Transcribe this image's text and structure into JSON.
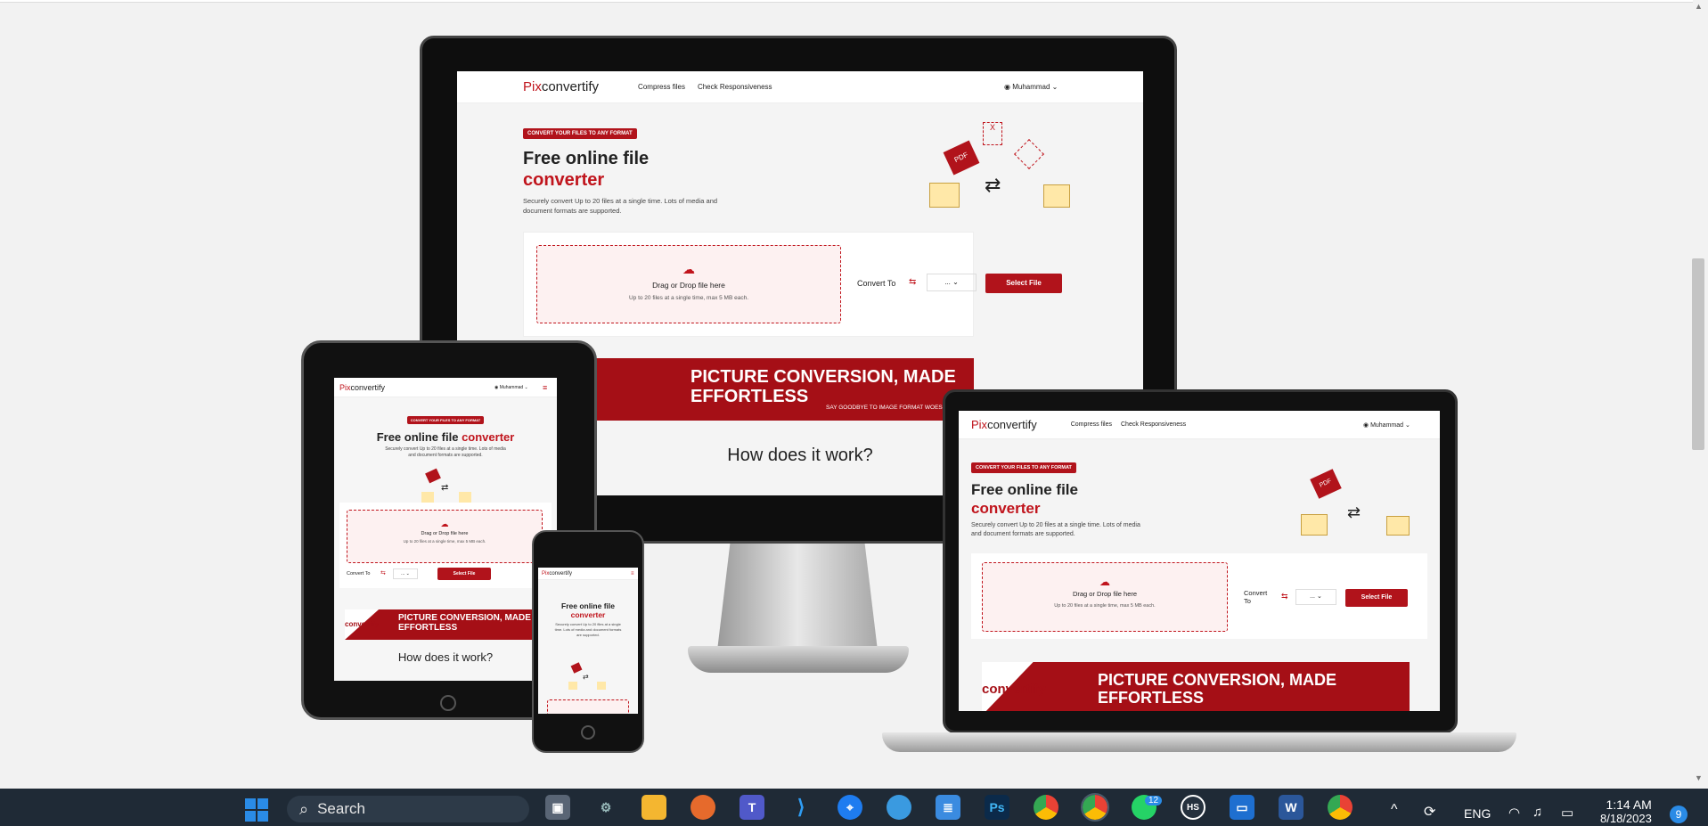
{
  "site": {
    "logo_pix": "Pix",
    "logo_rest": "convertify",
    "nav_compress": "Compress files",
    "nav_responsive": "Check Responsiveness",
    "user": "Muhammad",
    "badge": "Convert your files to any format",
    "title_line1": "Free online file",
    "title_line2": "converter",
    "subtitle": "Securely convert Up to 20 files at a single time. Lots of media and document formats are supported.",
    "drop_title": "Drag or Drop file here",
    "drop_sub": "Up to 20 files at a single time, max 5 MB each.",
    "convert_to": "Convert To",
    "select_value": "...",
    "select_file": "Select File",
    "banner_line1": "PICTURE CONVERSION, MADE",
    "banner_line2": "EFFORTLESS",
    "banner_sub": "SAY GOODBYE TO IMAGE FORMAT WOES! PIXCONVERTIFY EMPOWERS YOU TO EFFORTLESSLY CONVERT YOUR PICTURES",
    "banner_logo": "convertify",
    "how": "How does it work?"
  },
  "taskbar": {
    "search_placeholder": "Search",
    "language": "ENG",
    "time": "1:14 AM",
    "date": "8/18/2023",
    "notification_count": "9",
    "teams_badge": "12",
    "colors": {
      "bar": "#1f2a36",
      "accent": "#c0141c"
    }
  }
}
